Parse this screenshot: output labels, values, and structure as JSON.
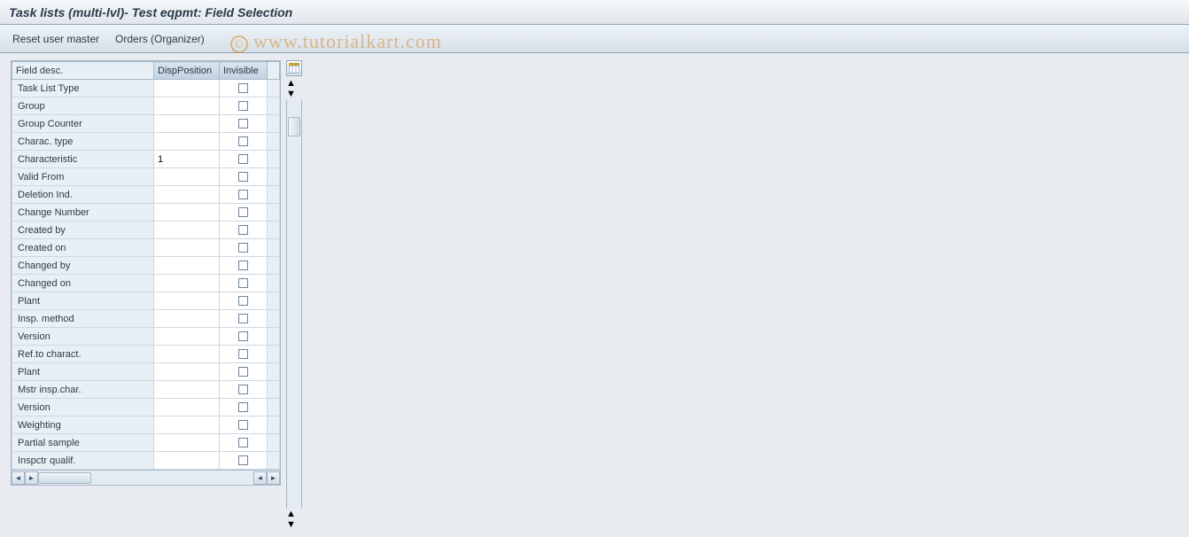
{
  "header": {
    "title": "Task lists (multi-lvl)- Test eqpmt: Field Selection"
  },
  "toolbar": {
    "reset_user_master": "Reset user master",
    "orders_organizer": "Orders (Organizer)"
  },
  "watermark": "www.tutorialkart.com",
  "grid": {
    "columns": {
      "field_desc": "Field desc.",
      "disp_position": "DispPosition",
      "invisible": "Invisible"
    },
    "rows": [
      {
        "desc": "Task List Type",
        "disp": "",
        "inv": false
      },
      {
        "desc": "Group",
        "disp": "",
        "inv": false
      },
      {
        "desc": "Group Counter",
        "disp": "",
        "inv": false
      },
      {
        "desc": "Charac. type",
        "disp": "",
        "inv": false
      },
      {
        "desc": "Characteristic",
        "disp": "1",
        "inv": false
      },
      {
        "desc": "Valid From",
        "disp": "",
        "inv": false
      },
      {
        "desc": "Deletion Ind.",
        "disp": "",
        "inv": false
      },
      {
        "desc": "Change Number",
        "disp": "",
        "inv": false
      },
      {
        "desc": "Created by",
        "disp": "",
        "inv": false
      },
      {
        "desc": "Created on",
        "disp": "",
        "inv": false
      },
      {
        "desc": "Changed by",
        "disp": "",
        "inv": false
      },
      {
        "desc": "Changed on",
        "disp": "",
        "inv": false
      },
      {
        "desc": "Plant",
        "disp": "",
        "inv": false
      },
      {
        "desc": "Insp. method",
        "disp": "",
        "inv": false
      },
      {
        "desc": "Version",
        "disp": "",
        "inv": false
      },
      {
        "desc": "Ref.to charact.",
        "disp": "",
        "inv": false
      },
      {
        "desc": "Plant",
        "disp": "",
        "inv": false
      },
      {
        "desc": "Mstr insp.char.",
        "disp": "",
        "inv": false
      },
      {
        "desc": "Version",
        "disp": "",
        "inv": false
      },
      {
        "desc": "Weighting",
        "disp": "",
        "inv": false
      },
      {
        "desc": "Partial sample",
        "disp": "",
        "inv": false
      },
      {
        "desc": "Inspctr qualif.",
        "disp": "",
        "inv": false
      }
    ]
  }
}
